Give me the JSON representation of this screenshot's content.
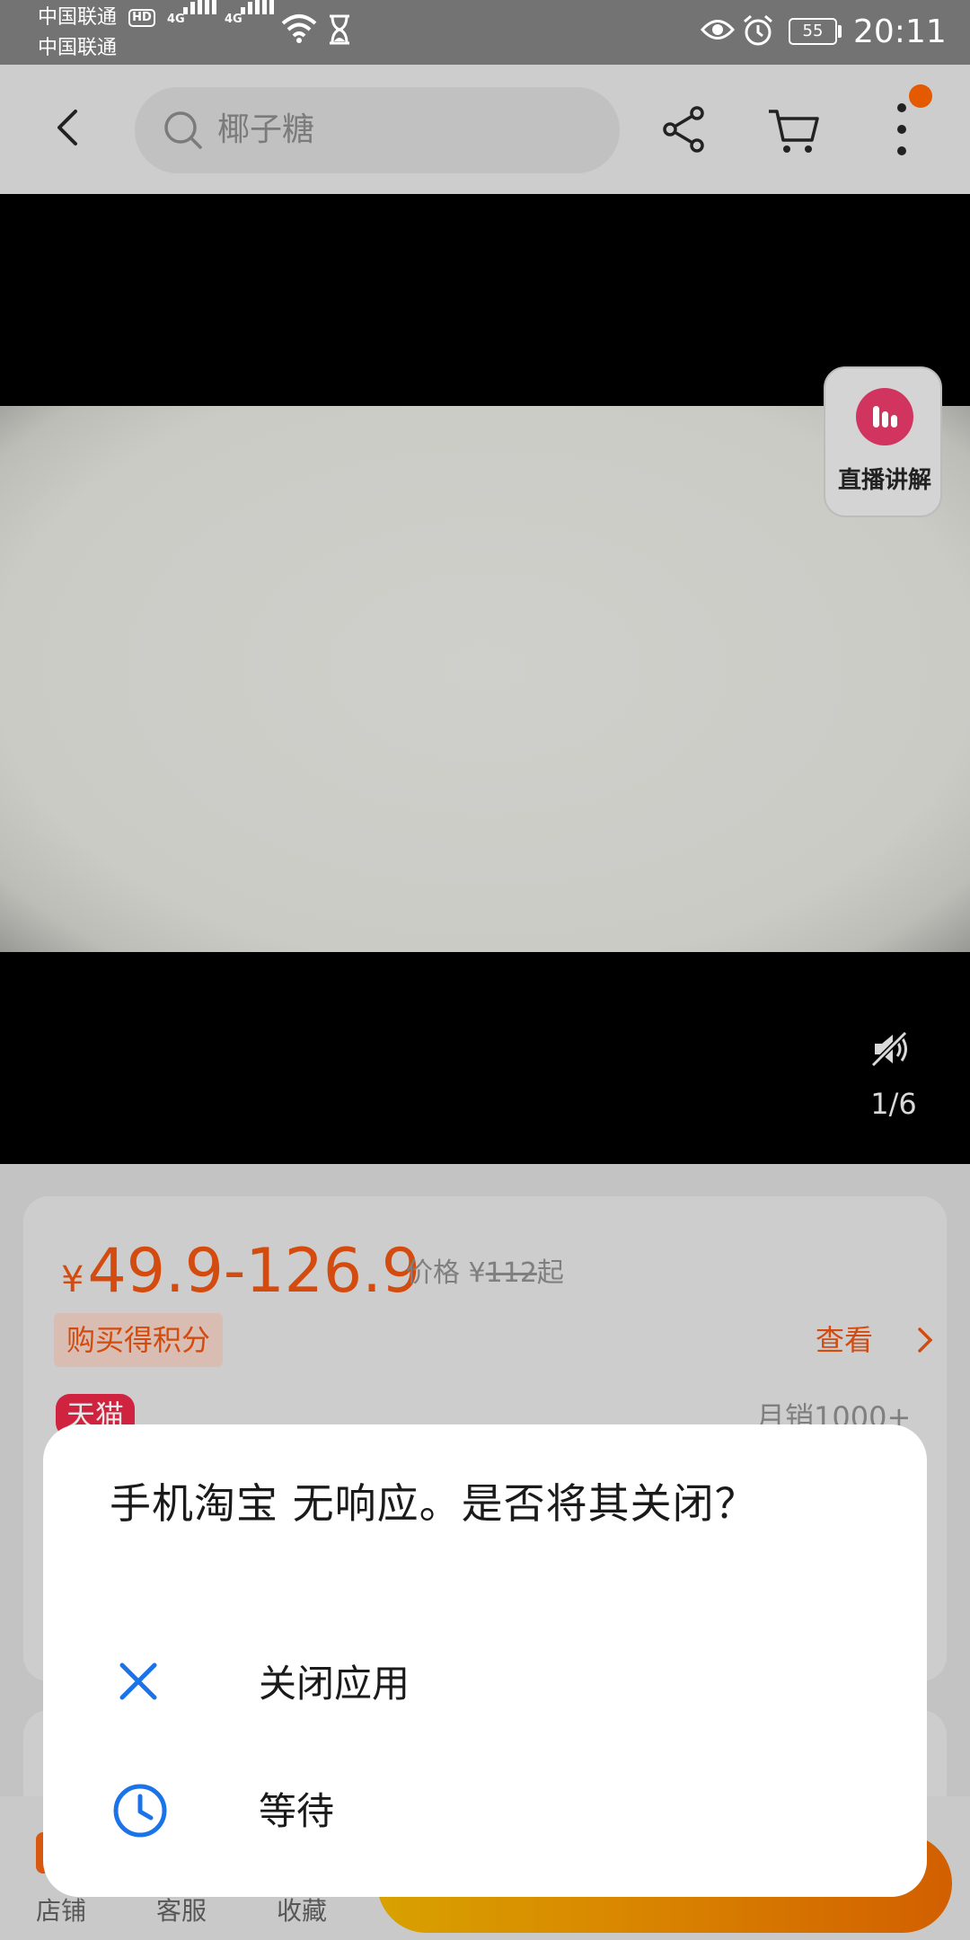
{
  "status_bar": {
    "carrier_1": "中国联通",
    "carrier_2": "中国联通",
    "hd_badge": "HD",
    "network_1": "4G",
    "network_2": "4G",
    "battery": "55",
    "time": "20:11"
  },
  "app_bar": {
    "search_placeholder": "椰子糖",
    "icons": [
      "back-icon",
      "search-icon",
      "share-icon",
      "cart-icon",
      "more-vertical-icon"
    ]
  },
  "media": {
    "live_label": "直播讲解",
    "page_counter": "1/6"
  },
  "product": {
    "currency": "¥",
    "price_range": "49.9-126.9",
    "price_label": "价格",
    "price_currency": "¥",
    "original_price": "112",
    "price_suffix": "起",
    "points_tag": "购买得积分",
    "view_link": "查看",
    "tmall_badge": "天猫",
    "monthly_sales": "月销1000+"
  },
  "bottom_nav": {
    "items": [
      {
        "label": "店铺"
      },
      {
        "label": "客服"
      },
      {
        "label": "收藏"
      }
    ]
  },
  "dialog": {
    "title": "手机淘宝 无响应。是否将其关闭？",
    "close_app_label": "关闭应用",
    "wait_label": "等待",
    "accent_color": "#1a73e8"
  },
  "colors": {
    "price": "#d34b0e",
    "tmall": "#cf2340",
    "live": "#d0345f"
  }
}
